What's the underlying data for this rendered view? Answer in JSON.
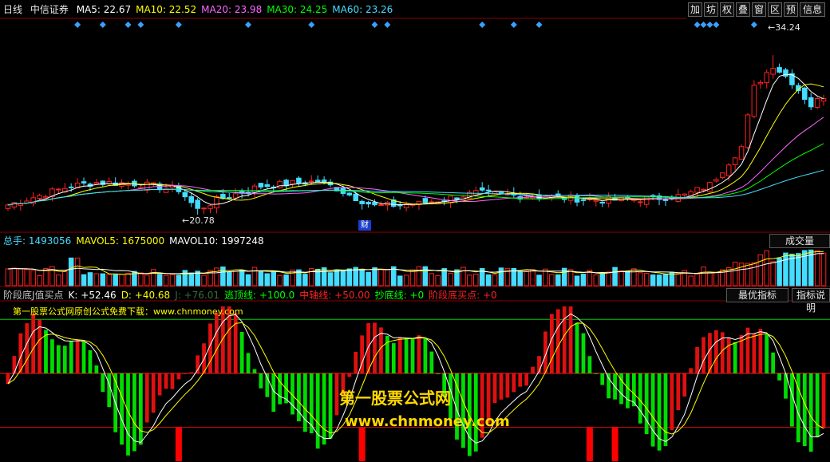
{
  "header": {
    "period": "日线",
    "stock": "中信证券",
    "ma": [
      {
        "label": "MA5: 22.67",
        "color": "#ffffff"
      },
      {
        "label": "MA10: 22.52",
        "color": "#ffff00"
      },
      {
        "label": "MA20: 23.98",
        "color": "#ff66ff"
      },
      {
        "label": "MA30: 24.25",
        "color": "#00ff00"
      },
      {
        "label": "MA60: 23.26",
        "color": "#44ddff"
      }
    ]
  },
  "toolbar": {
    "items": [
      "加",
      "坊",
      "权",
      "叠",
      "窗",
      "区",
      "预",
      "信息"
    ]
  },
  "price_labels": {
    "high": "34.24",
    "low": "20.78",
    "finance_marker": "财"
  },
  "volume_header": [
    {
      "label": "总手: 1493056",
      "color": "#44ddff"
    },
    {
      "label": "MAVOL5: 1675000",
      "color": "#ffff00"
    },
    {
      "label": "MAVOL10: 1997248",
      "color": "#ffffff"
    }
  ],
  "volume_button": "成交量",
  "indicator_header": [
    {
      "label": "阶段底J值买点",
      "color": "#c0c0c0"
    },
    {
      "label": "K: +52.46",
      "color": "#ffffff"
    },
    {
      "label": "D: +40.68",
      "color": "#ffff00"
    },
    {
      "label": "J: +76.01",
      "color": "#3a6b3a"
    },
    {
      "label": "逃顶线: +100.0",
      "color": "#00ff00"
    },
    {
      "label": "中轴线: +50.00",
      "color": "#ff2020"
    },
    {
      "label": "抄底线: +0",
      "color": "#00ff00"
    },
    {
      "label": "阶段底买点: +0",
      "color": "#ff2020"
    }
  ],
  "indicator_buttons": {
    "best": "最优指标",
    "help": "指标说明"
  },
  "indicator_note": "第一股票公式网原创公式免费下载：www.chnmoney.com",
  "watermark": {
    "line1": "第一股票公式网",
    "line2": "www.chnmoney.com"
  },
  "colors": {
    "up": "#ff2020",
    "down": "#44ddff",
    "ma5": "#ffffff",
    "ma10": "#ffff00",
    "ma20": "#ff66ff",
    "ma30": "#00ff00",
    "ma60": "#44ddff"
  },
  "chart_data": {
    "type": "candlestick",
    "price_range": [
      19.5,
      36.2
    ],
    "bars": 130,
    "ohlc_anchors": [
      [
        0,
        21.6
      ],
      [
        10,
        23.2
      ],
      [
        14,
        23.5
      ],
      [
        20,
        23.4
      ],
      [
        27,
        22.9
      ],
      [
        30,
        21.2
      ],
      [
        33,
        22.0
      ],
      [
        40,
        23.2
      ],
      [
        49,
        23.6
      ],
      [
        52,
        23.0
      ],
      [
        55,
        22.2
      ],
      [
        58,
        21.5
      ],
      [
        65,
        21.7
      ],
      [
        74,
        22.6
      ],
      [
        80,
        22.4
      ],
      [
        88,
        22.2
      ],
      [
        94,
        22.0
      ],
      [
        101,
        22.1
      ],
      [
        107,
        22.4
      ],
      [
        111,
        23.3
      ],
      [
        116,
        26.5
      ],
      [
        118,
        31.5
      ],
      [
        121,
        33.4
      ],
      [
        124,
        32.0
      ],
      [
        127,
        30.0
      ],
      [
        129,
        30.8
      ]
    ],
    "volume_range": [
      0,
      3600000
    ],
    "indicator_range": [
      -30,
      115
    ],
    "reference_lines": [
      100,
      50,
      0
    ],
    "buy_markers": [
      27,
      56,
      92,
      96
    ]
  }
}
